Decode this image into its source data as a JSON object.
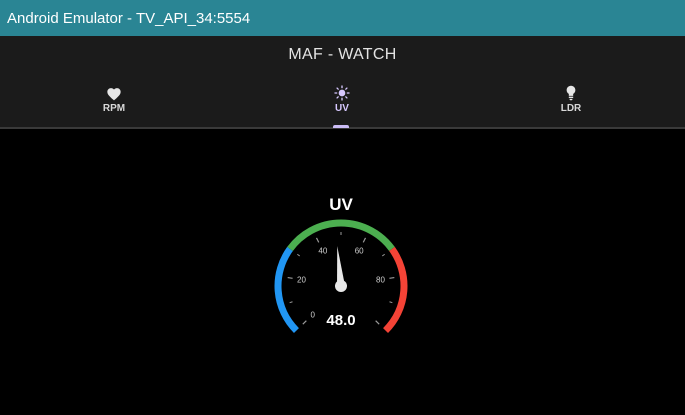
{
  "window": {
    "title": "Android Emulator - TV_API_34:5554"
  },
  "app": {
    "title": "MAF - WATCH"
  },
  "tabs": [
    {
      "label": "RPM",
      "icon": "heart-icon",
      "active": false
    },
    {
      "label": "UV",
      "icon": "sun-icon",
      "active": true
    },
    {
      "label": "LDR",
      "icon": "lightbulb-icon",
      "active": false
    }
  ],
  "gauge": {
    "title": "UV",
    "value": 48.0,
    "value_text": "48.0",
    "min": 0,
    "max": 100,
    "tick_labels": [
      "0",
      "20",
      "40",
      "60",
      "80"
    ],
    "ranges": [
      {
        "from": 0,
        "to": 30,
        "color": "#2196f3"
      },
      {
        "from": 30,
        "to": 70,
        "color": "#4caf50"
      },
      {
        "from": 70,
        "to": 100,
        "color": "#f44336"
      }
    ]
  },
  "colors": {
    "titlebar": "#2a8594",
    "appbar": "#1b1b1b",
    "active_tab": "#d7c8ff",
    "needle": "#e8e8e8"
  }
}
